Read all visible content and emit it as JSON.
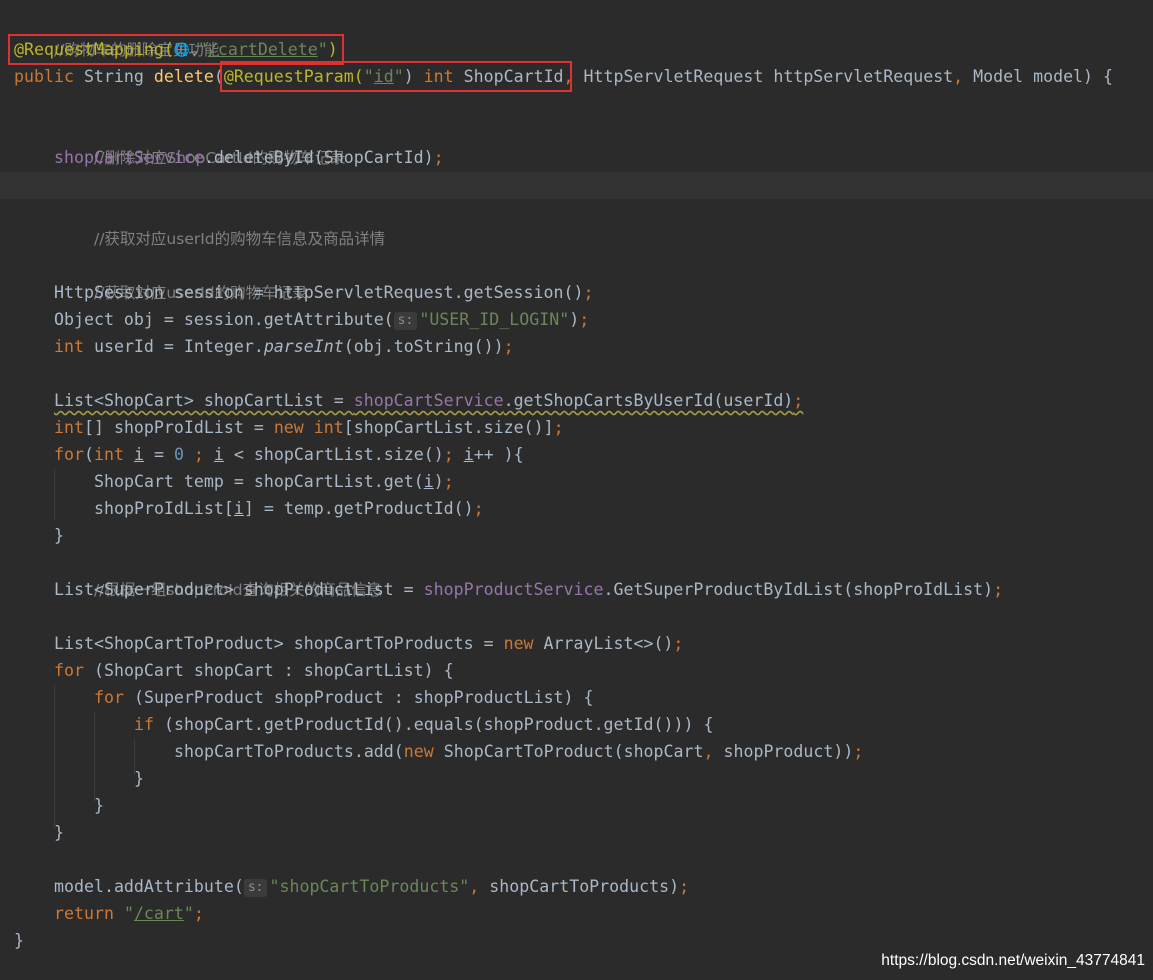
{
  "code": {
    "l1_comment": "//购物车的删除宝贝功能",
    "l2_annotation": "@RequestMapping(",
    "l2_globe": "🌐",
    "l2_chevron": "⌄",
    "l2_q1": "\"",
    "l2_path": "/cartDelete",
    "l2_q2": "\"",
    "l2_close": ")",
    "l3_public": "public ",
    "l3_string": "String ",
    "l3_delete": "delete",
    "l3_open": "(",
    "l3_reqparam": "@RequestParam(",
    "l3_q1": "\"",
    "l3_id": "id",
    "l3_q2": "\"",
    "l3_close": ") ",
    "l3_int": "int ",
    "l3_shopcartid": "ShopCartId",
    "l3_comma1": ", ",
    "l3_req": "HttpServletRequest httpServletRequest",
    "l3_comma2": ", ",
    "l3_model": "Model model) {",
    "l5_comment": "//删除对应ShopCartId的购物车记录",
    "l6_field": "shopCartService",
    "l6_call": ".deleteById(ShopCartId)",
    "l6_semi": ";",
    "l8_comment": "//获取对应userId的购物车信息及商品详情",
    "l10_comment": "//获取对应userId的购物车记录",
    "l11_text": "HttpSession session = httpServletRequest.getSession()",
    "l11_semi": ";",
    "l12_text": "Object obj = session.getAttribute(",
    "l12_hint": "s:",
    "l12_str": "\"USER_ID_LOGIN\"",
    "l12_close": ")",
    "l12_semi": ";",
    "l13_int": "int ",
    "l13_text": "userId = Integer.",
    "l13_parse": "parseInt",
    "l13_rest": "(obj.toString())",
    "l13_semi": ";",
    "l15_a": "List<ShopCart> shopCartList = ",
    "l15_field": "shopCartService",
    "l15_b": ".getShopCartsByUserId(userId)",
    "l15_semi": ";",
    "l16_int": "int",
    "l16_a": "[] shopProIdList = ",
    "l16_new": "new ",
    "l16_int2": "int",
    "l16_b": "[shopCartList.size()]",
    "l16_semi": ";",
    "l17_for": "for",
    "l17_open": "(",
    "l17_int": "int ",
    "l17_i1": "i",
    "l17_eq": " = ",
    "l17_zero": "0",
    "l17_semi1": " ; ",
    "l17_i2": "i",
    "l17_mid": " < shopCartList.size()",
    "l17_semi2": "; ",
    "l17_i3": "i",
    "l17_end": "++ ){",
    "l18_a": "ShopCart temp = shopCartList.get(",
    "l18_i": "i",
    "l18_close": ")",
    "l18_semi": ";",
    "l19_a": "shopProIdList[",
    "l19_i": "i",
    "l19_b": "] = temp.getProductId()",
    "l19_semi": ";",
    "l20_brace": "}",
    "l21_comment": "//根据一组shopProId查询相关的商品信息",
    "l22_a": "List<SuperProduct> shopProductList = ",
    "l22_field": "shopProductService",
    "l22_b": ".GetSuperProductByIdList(shopProIdList)",
    "l22_semi": ";",
    "l24_a": "List<ShopCartToProduct> shopCartToProducts = ",
    "l24_new": "new ",
    "l24_b": "ArrayList<>()",
    "l24_semi": ";",
    "l25_for": "for ",
    "l25_a": "(ShopCart shopCart : shopCartList) {",
    "l26_for": "for ",
    "l26_a": "(SuperProduct shopProduct : shopProductList) {",
    "l27_if": "if ",
    "l27_a": "(shopCart.getProductId().equals(shopProduct.getId())) {",
    "l28_a": "shopCartToProducts.add(",
    "l28_new": "new ",
    "l28_b": "ShopCartToProduct(shopCart",
    "l28_comma": ", ",
    "l28_c": "shopProduct))",
    "l28_semi": ";",
    "l29_brace": "}",
    "l30_brace": "}",
    "l31_brace": "}",
    "l33_a": "model.addAttribute(",
    "l33_hint": "s:",
    "l33_str": "\"shopCartToProducts\"",
    "l33_comma": ", ",
    "l33_b": "shopCartToProducts)",
    "l33_semi": ";",
    "l34_return": "return ",
    "l34_q1": "\"",
    "l34_path": "/cart",
    "l34_q2": "\"",
    "l34_semi": ";",
    "l35_brace": "}"
  },
  "watermark": "https://blog.csdn.net/weixin_43774841",
  "colors": {
    "background": "#2b2b2b",
    "current_line": "#323232",
    "text": "#a9b7c6",
    "keyword": "#cc7832",
    "string": "#6a8759",
    "comment": "#808080",
    "annotation": "#bbb529",
    "method_decl": "#ffc66d",
    "field": "#9876aa",
    "number": "#6897bb",
    "highlight_box": "#e03131"
  },
  "icons": [
    "globe-icon",
    "chevron-down-icon"
  ]
}
